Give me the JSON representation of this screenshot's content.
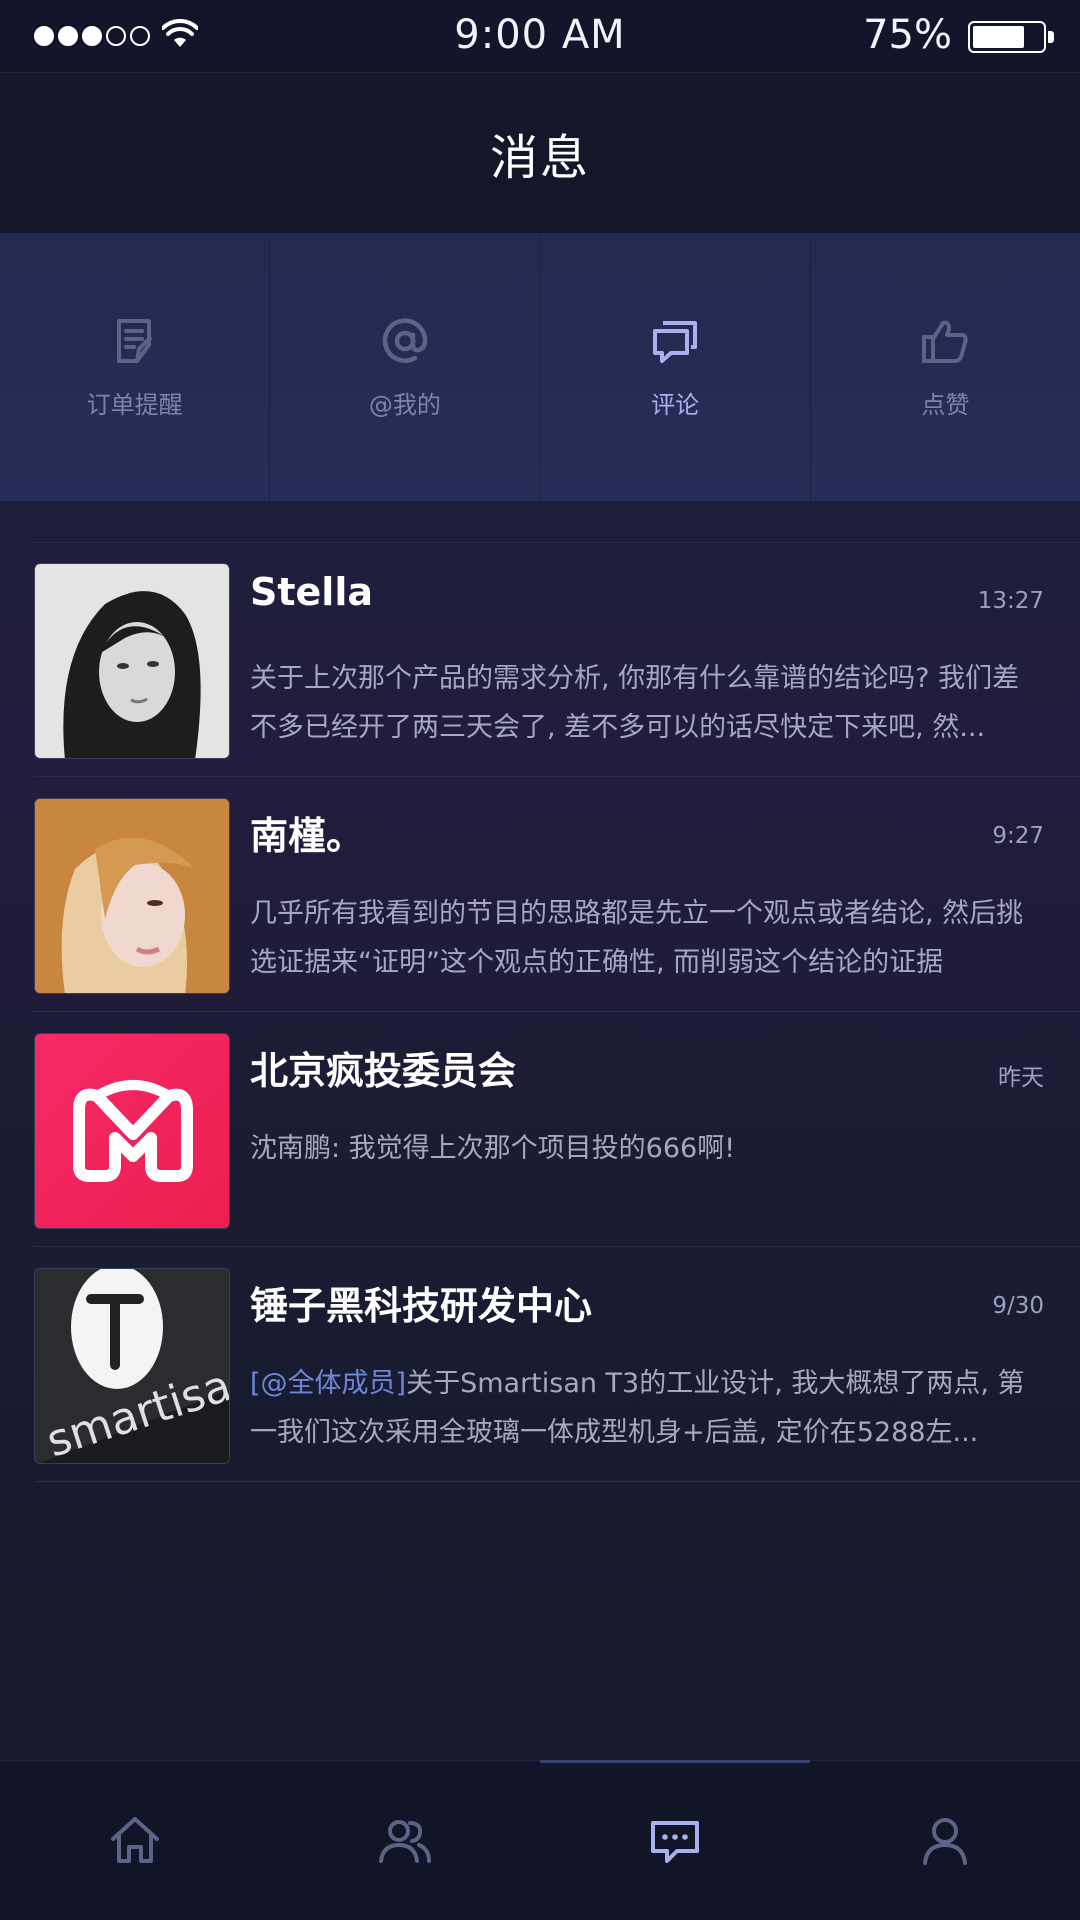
{
  "status_bar": {
    "signal_dots_filled": 3,
    "signal_dots_total": 5,
    "time": "9:00 AM",
    "battery_percent": "75%",
    "battery_level": 0.75
  },
  "header": {
    "title": "消息"
  },
  "category_tabs": [
    {
      "label": "订单提醒",
      "icon": "order-note-icon",
      "active": false
    },
    {
      "label": "@我的",
      "icon": "at-icon",
      "active": false
    },
    {
      "label": "评论",
      "icon": "comment-icon",
      "active": true
    },
    {
      "label": "点赞",
      "icon": "thumbs-up-icon",
      "active": false
    }
  ],
  "messages": [
    {
      "name": "Stella",
      "time": "13:27",
      "avatar": "avatar-photo-woman-bw",
      "preview": "关于上次那个产品的需求分析, 你那有什么靠谱的结论吗? 我们差不多已经开了两三天会了, 差不多可以的话尽快定下来吧, 然...",
      "mention": ""
    },
    {
      "name": "南槿。",
      "time": "9:27",
      "avatar": "avatar-photo-woman-color",
      "preview": "几乎所有我看到的节目的思路都是先立一个观点或者结论, 然后挑选证据来“证明”这个观点的正确性, 而削弱这个结论的证据",
      "mention": ""
    },
    {
      "name": "北京疯投委员会",
      "time": "昨天",
      "avatar": "group-logo-m",
      "preview": "沈南鹏: 我觉得上次那个项目投的666啊!",
      "mention": ""
    },
    {
      "name": "锤子黑科技研发中心",
      "time": "9/30",
      "avatar": "smartisan-logo",
      "mention": "[@全体成员]",
      "preview": "关于Smartisan T3的工业设计, 我大概想了两点, 第一我们这次采用全玻璃一体成型机身+后盖, 定价在5288左..."
    }
  ],
  "tab_bar": [
    {
      "icon": "home-icon",
      "active": false
    },
    {
      "icon": "contacts-icon",
      "active": false
    },
    {
      "icon": "messages-icon",
      "active": true
    },
    {
      "icon": "profile-icon",
      "active": false
    }
  ],
  "colors": {
    "background": "#171a2c",
    "active_accent": "#a8b0f0",
    "inactive_icon": "#5c6385",
    "mention": "#6c86d8",
    "brand_pink": "#f0245a"
  }
}
